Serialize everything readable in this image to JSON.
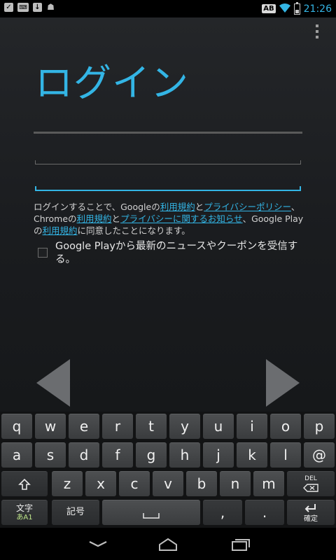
{
  "status_bar": {
    "time": "21:26",
    "ab_badge": "AB",
    "notification_icons": [
      "check-icon",
      "keyboard-icon",
      "download-icon",
      "android-icon"
    ]
  },
  "login": {
    "title": "ログイン",
    "email_value": "",
    "password_value": "",
    "terms": {
      "text_1": "ログインすることで、Googleの",
      "link_google_terms": "利用規約",
      "text_2": "と",
      "link_google_privacy": "プライバシーポリシー",
      "text_3": "、Chromeの",
      "link_chrome_terms": "利用規約",
      "text_4": "と",
      "link_chrome_privacy": "プライバシーに関するお知らせ",
      "text_5": "、Google Playの",
      "link_play_terms": "利用規約",
      "text_6": "に同意したことになります。"
    },
    "newsletter_label": "Google Playから最新のニュースやクーポンを受信する。",
    "newsletter_checked": false
  },
  "keyboard": {
    "row1": [
      "q",
      "w",
      "e",
      "r",
      "t",
      "y",
      "u",
      "i",
      "o",
      "p"
    ],
    "row2": [
      "a",
      "s",
      "d",
      "f",
      "g",
      "h",
      "j",
      "k",
      "l",
      "@"
    ],
    "row3": [
      "z",
      "x",
      "c",
      "v",
      "b",
      "n",
      "m"
    ],
    "del_label": "DEL",
    "mode_label": "文字",
    "mode_sub": "あA1",
    "symbol_label": "記号",
    "comma": ",",
    "period": ".",
    "enter_label": "確定"
  },
  "colors": {
    "accent": "#33b5e5",
    "background": "#1a1c1f",
    "key": "#3f4143"
  }
}
